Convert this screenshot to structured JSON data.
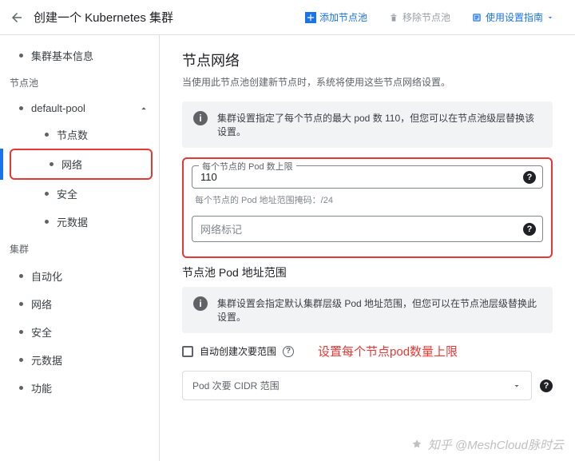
{
  "topbar": {
    "title": "创建一个 Kubernetes 集群",
    "actions": {
      "add": "添加节点池",
      "remove": "移除节点池",
      "guide": "使用设置指南"
    }
  },
  "sidebar": {
    "cluster_info": "集群基本信息",
    "section_pools": "节点池",
    "pool_name": "default-pool",
    "pool_items": {
      "nodes": "节点数",
      "network": "网络",
      "security": "安全",
      "metadata": "元数据"
    },
    "section_cluster": "集群",
    "cluster_items": {
      "automation": "自动化",
      "network": "网络",
      "security": "安全",
      "metadata": "元数据",
      "features": "功能"
    }
  },
  "main": {
    "heading": "节点网络",
    "desc": "当使用此节点池创建新节点时，系统将使用这些节点网络设置。",
    "info1": "集群设置指定了每个节点的最大 pod 数 110，但您可以在节点池级层替换该设置。",
    "field_pod_label": "每个节点的 Pod 数上限",
    "field_pod_value": "110",
    "mask_note": "每个节点的 Pod 地址范围掩码：/24",
    "field_tag_placeholder": "网络标记",
    "heading2": "节点池 Pod 地址范围",
    "info2": "集群设置会指定默认集群层级 Pod 地址范围，但您可以在节点池层级替换此设置。",
    "checkbox_label": "自动创建次要范围",
    "annotation": "设置每个节点pod数量上限",
    "select_placeholder": "Pod 次要 CIDR 范围"
  },
  "watermark": "知乎 @MeshCloud脉时云"
}
